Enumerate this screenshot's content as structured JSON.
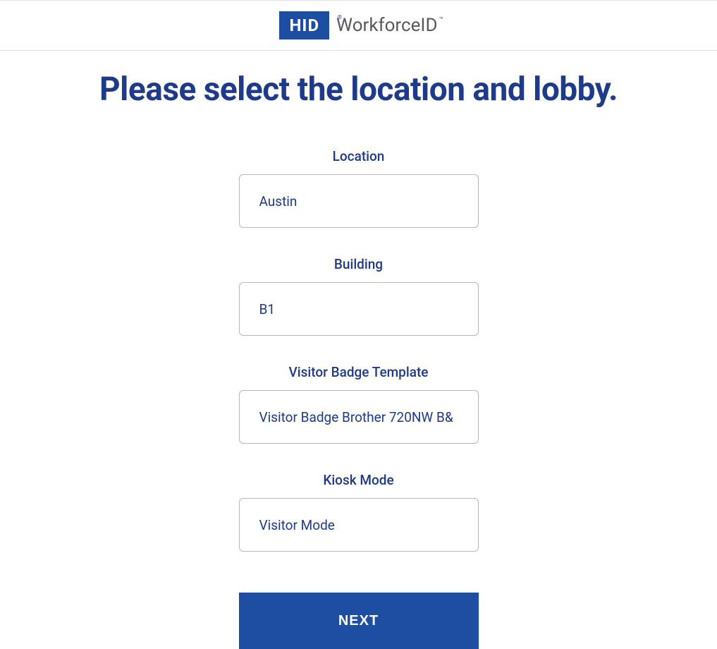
{
  "header": {
    "logo_badge": "HID",
    "logo_text": "WorkforceID"
  },
  "page_title": "Please select the location and lobby.",
  "form": {
    "location": {
      "label": "Location",
      "value": "Austin"
    },
    "building": {
      "label": "Building",
      "value": "B1"
    },
    "visitor_badge_template": {
      "label": "Visitor Badge Template",
      "value": "Visitor Badge Brother 720NW B&"
    },
    "kiosk_mode": {
      "label": "Kiosk Mode",
      "value": "Visitor Mode"
    }
  },
  "actions": {
    "next_label": "NEXT"
  }
}
